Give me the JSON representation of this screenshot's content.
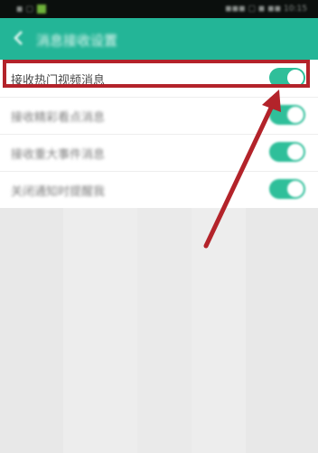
{
  "page": {
    "title": "消息接收设置"
  },
  "status_bar": {
    "left_text": "◼ ▢",
    "right_text": "◼◼◼ ▢ ◼ ◼◼ 10:15"
  },
  "settings": [
    {
      "label": "接收热门视频消息",
      "enabled": true,
      "highlighted": true
    },
    {
      "label": "接收精彩看点消息",
      "enabled": true,
      "highlighted": false
    },
    {
      "label": "接收重大事件消息",
      "enabled": true,
      "highlighted": false
    },
    {
      "label": "关闭通知时提醒我",
      "enabled": true,
      "highlighted": false
    }
  ],
  "colors": {
    "accent": "#23b597",
    "toggle_on": "#2fbf9a",
    "annotation": "#b3232a"
  }
}
